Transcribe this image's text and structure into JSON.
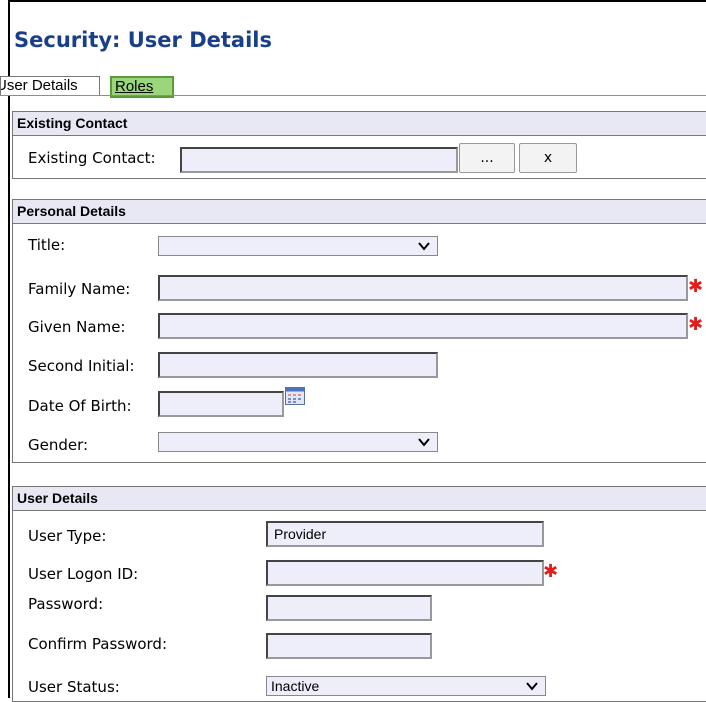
{
  "page": {
    "title": "Security: User Details"
  },
  "tabs": [
    {
      "label": "User Details"
    },
    {
      "label": "Roles"
    }
  ],
  "existing_contact": {
    "header": "Existing Contact",
    "label": "Existing Contact:",
    "value": "",
    "browse_label": "...",
    "clear_label": "x"
  },
  "personal_details": {
    "header": "Personal Details",
    "title_label": "Title:",
    "title_value": "",
    "family_name_label": "Family Name:",
    "family_name_value": "",
    "given_name_label": "Given Name:",
    "given_name_value": "",
    "second_initial_label": "Second Initial:",
    "second_initial_value": "",
    "dob_label": "Date Of Birth:",
    "dob_value": "",
    "gender_label": "Gender:",
    "gender_value": ""
  },
  "user_details": {
    "header": "User Details",
    "user_type_label": "User Type:",
    "user_type_value": "Provider",
    "logon_label": "User Logon ID:",
    "logon_value": "",
    "password_label": "Password:",
    "confirm_password_label": "Confirm Password:",
    "status_label": "User Status:",
    "status_value": "Inactive"
  },
  "required_marker": "✱",
  "colors": {
    "title": "#1a3f8a",
    "field_bg": "#eeeefb",
    "header_bg": "#e8e8f4",
    "roles_tab": "#9bd67a",
    "required": "#e31b1b"
  },
  "icons": {
    "calendar": "calendar-icon",
    "dropdown": "chevron-down-icon"
  }
}
